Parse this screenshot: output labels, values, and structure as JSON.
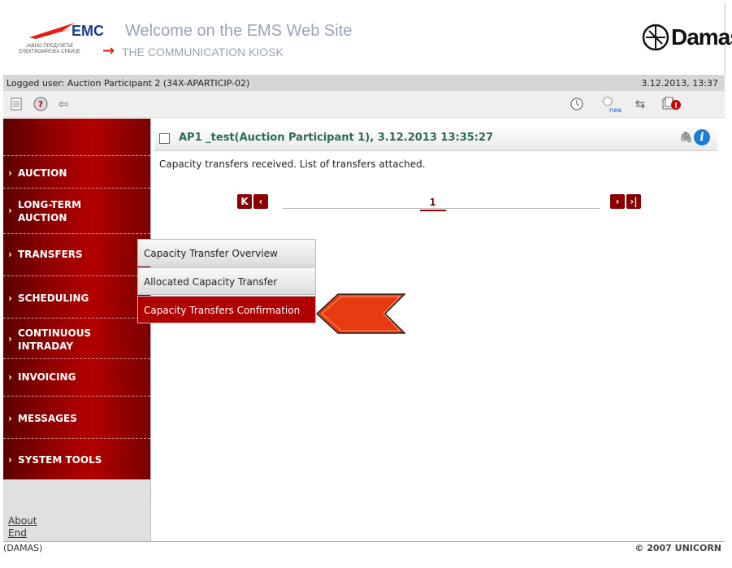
{
  "header": {
    "emc_logo": "EMC",
    "emc_sub": "ЈАВНО ПРЕДУЗЕЋЕ ЕЛЕКТРОМРЕЖА СРБИЈЕ",
    "welcome": "Welcome on the EMS Web Site",
    "kiosk": "THE COMMUNICATION KIOSK",
    "damas_logo": "Damas"
  },
  "status": {
    "logged_user": "Logged user: Auction Participant 2 (34X-APARTICIP-02)",
    "datetime": "3.12.2013, 13:37"
  },
  "toolbar": {
    "left_icons": [
      "document-icon",
      "help-icon",
      "back-arrow-icon"
    ],
    "right_icons": [
      "clock-icon",
      "new-bulb-icon",
      "transfer-arrows-icon",
      "alert-mail-icon"
    ]
  },
  "sidebar": {
    "items": [
      {
        "label": "AUCTION"
      },
      {
        "label": "LONG-TERM AUCTION"
      },
      {
        "label": "TRANSFERS"
      },
      {
        "label": "SCHEDULING"
      },
      {
        "label": "CONTINUOUS INTRADAY"
      },
      {
        "label": "INVOICING"
      },
      {
        "label": "MESSAGES"
      },
      {
        "label": "SYSTEM TOOLS"
      }
    ],
    "about": "About",
    "end": "End"
  },
  "submenu": {
    "items": [
      {
        "label": "Capacity Transfer Overview"
      },
      {
        "label": "Allocated Capacity Transfer"
      },
      {
        "label": "Capacity Transfers Confirmation"
      }
    ]
  },
  "message": {
    "title": "AP1 _test(Auction Participant 1), 3.12.2013 13:35:27",
    "body": "Capacity transfers received. List of transfers attached."
  },
  "pagination": {
    "current_page": "1"
  },
  "footer": {
    "left": "(DAMAS)",
    "right": "© 2007 UNICORN"
  },
  "colors": {
    "sidebar_red": "#b20000",
    "active_item": "#b00000",
    "callout": "#e83a10"
  }
}
